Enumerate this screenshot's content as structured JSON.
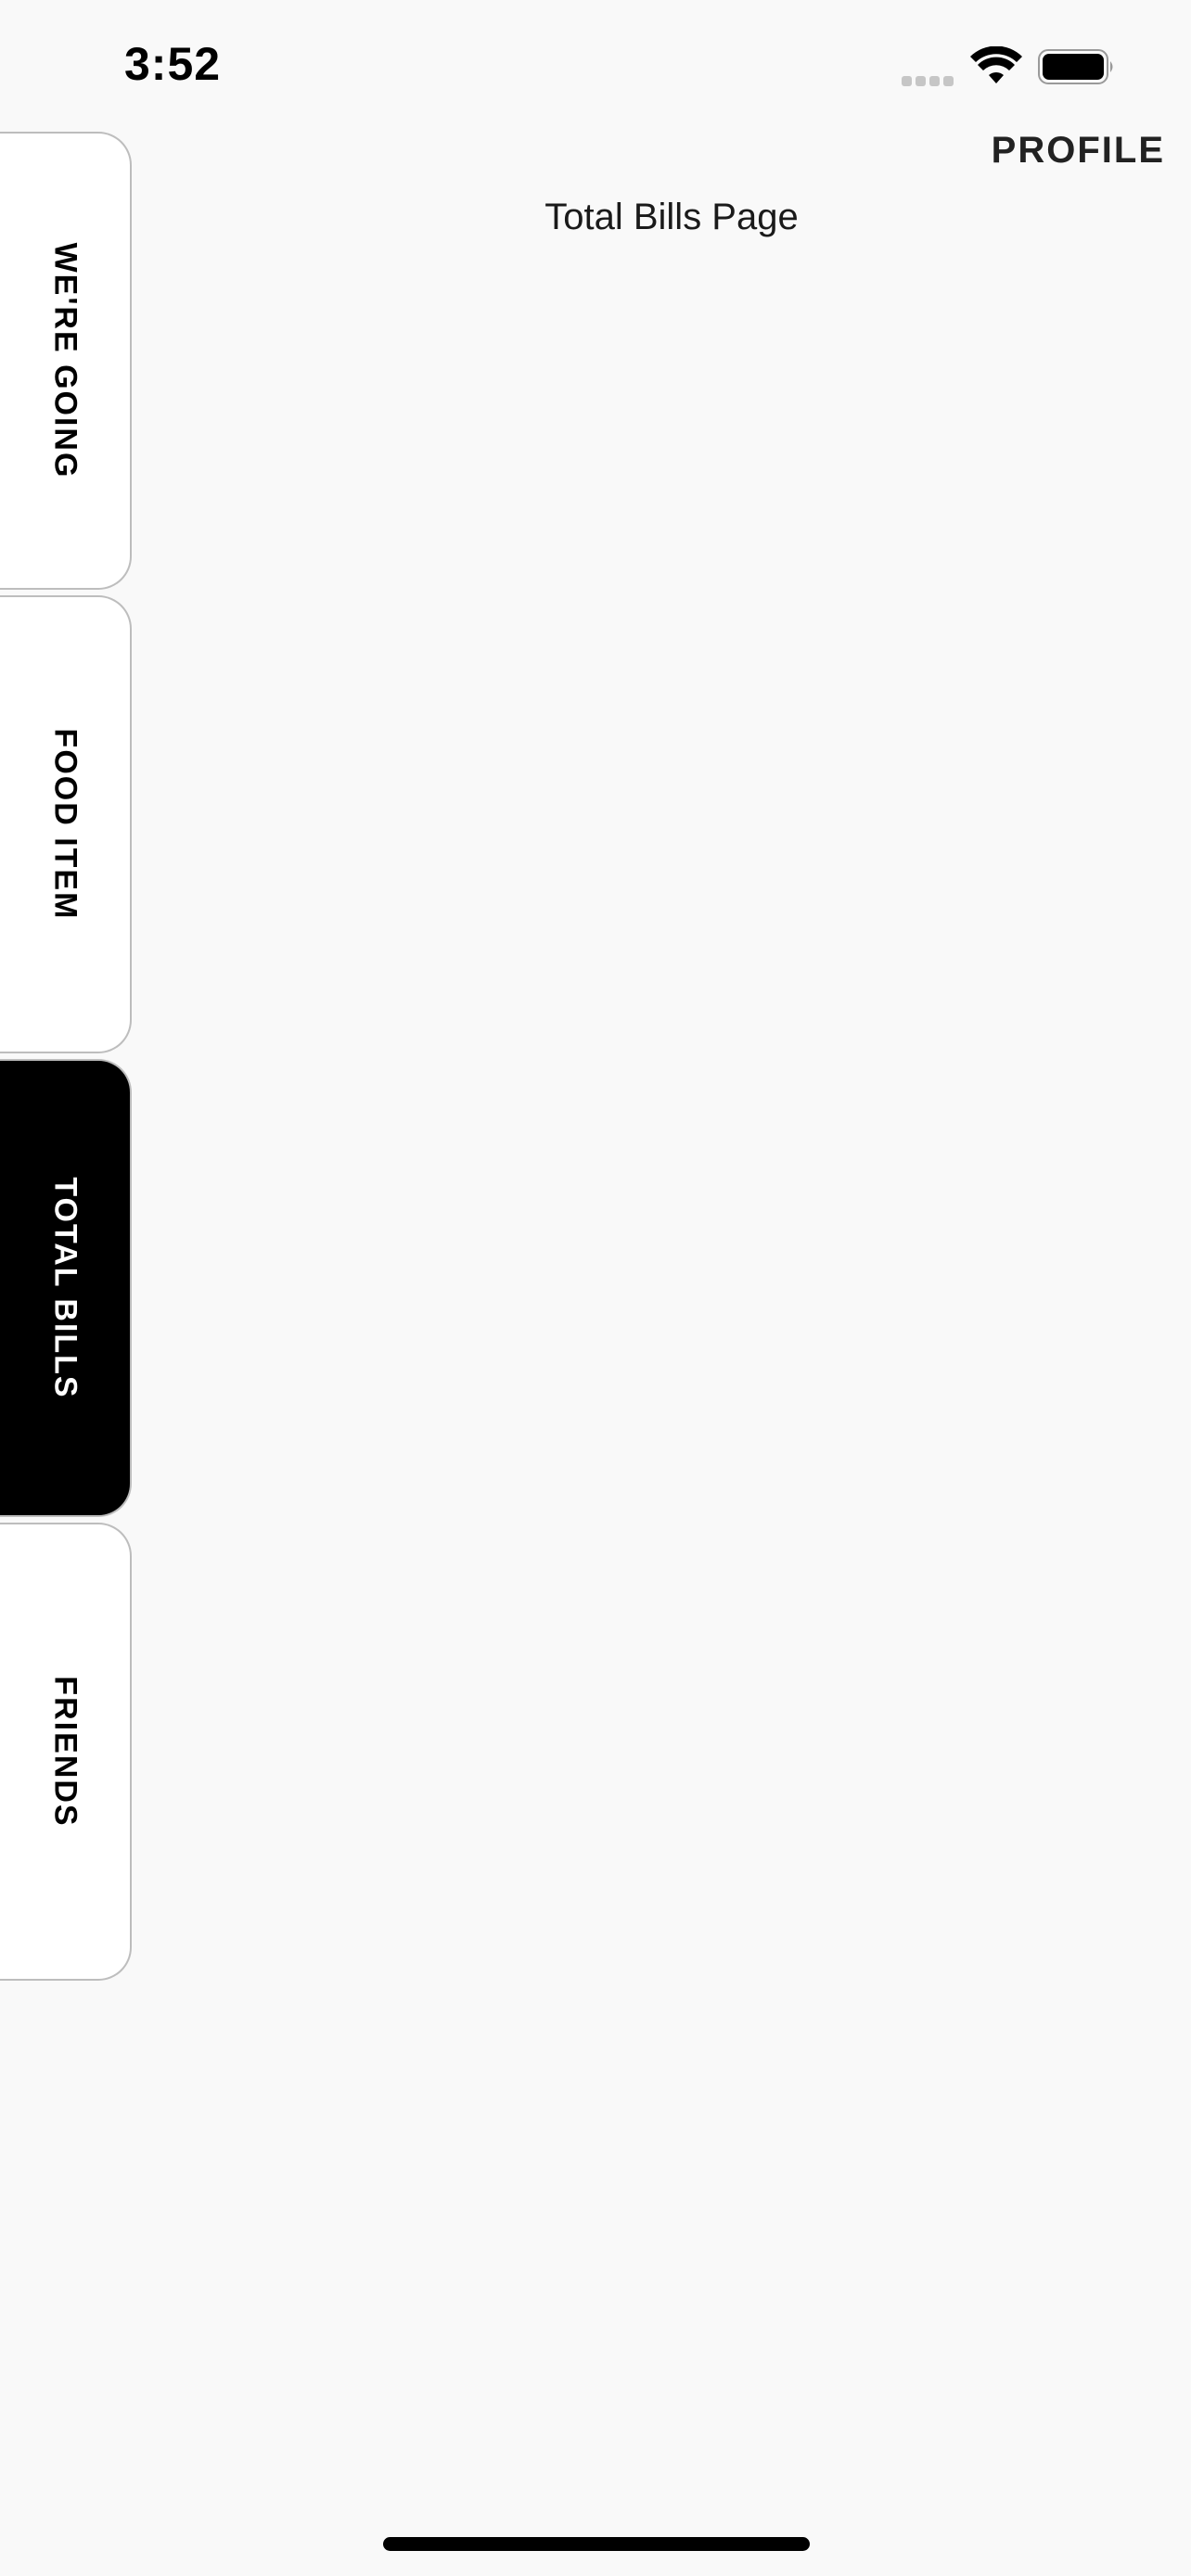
{
  "status_bar": {
    "time": "3:52",
    "icons": [
      "cellular-signal-icon",
      "wifi-icon",
      "battery-icon"
    ]
  },
  "header": {
    "profile_label": "PROFILE"
  },
  "main": {
    "title": "Total Bills Page"
  },
  "side_tabs": [
    {
      "label": "WE'RE GOING",
      "active": false
    },
    {
      "label": "FOOD ITEM",
      "active": false
    },
    {
      "label": "TOTAL BILLS",
      "active": true
    },
    {
      "label": "FRIENDS",
      "active": false
    }
  ],
  "colors": {
    "background": "#f9f9f9",
    "tab_inactive": "#ffffff",
    "tab_active": "#000000",
    "tab_border": "#bdbdbd",
    "text": "#000000"
  }
}
